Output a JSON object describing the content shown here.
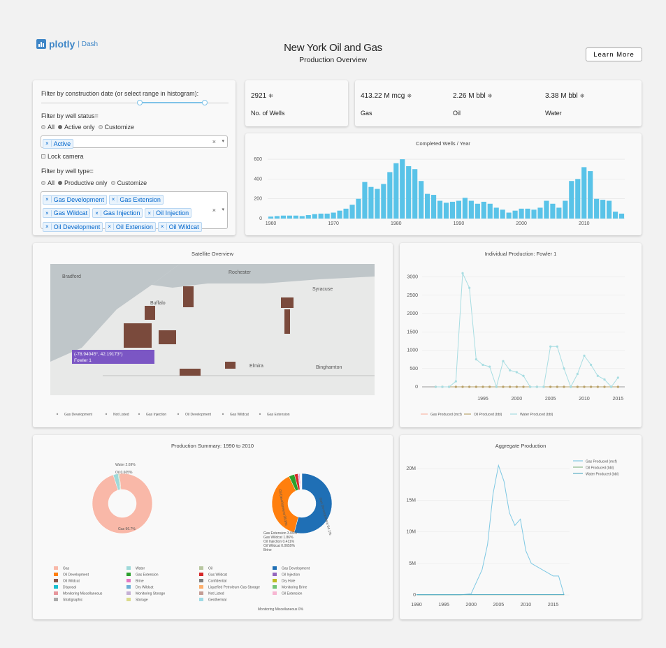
{
  "header": {
    "logo_text": "plotly",
    "logo_sub": "Dash",
    "title": "New York Oil and Gas",
    "subtitle": "Production Overview",
    "learn_more": "Learn More"
  },
  "controls": {
    "date_label": "Filter by construction date (or select range in histogram):",
    "status_label": "Filter by well status=",
    "status_options": [
      "All",
      "Active only",
      "Customize"
    ],
    "status_selected": "Active only",
    "status_tags": [
      "Active"
    ],
    "lock_camera": "Lock camera",
    "type_label": "Filter by well type=",
    "type_options": [
      "All",
      "Productive only",
      "Customize"
    ],
    "type_selected": "Productive only",
    "type_tags": [
      "Gas Development",
      "Gas Extension",
      "Gas Wildcat",
      "Gas Injection",
      "Oil Injection",
      "Oil Development",
      "Oil Extension",
      "Oil Wildcat"
    ]
  },
  "stats": [
    {
      "value": "2921",
      "label": "No. of Wells"
    },
    {
      "value": "413.22 M mcg",
      "label": "Gas"
    },
    {
      "value": "2.26 M bbl",
      "label": "Oil"
    },
    {
      "value": "3.38 M bbl",
      "label": "Water"
    }
  ],
  "map": {
    "title": "Satellite Overview",
    "tooltip_coords": "(-78.94045°, 42.19173°)",
    "tooltip_type": "Gas Extension",
    "tooltip_name": "Fowler 1",
    "legend": [
      "Gas Development",
      "Not Listed",
      "Gas Injection",
      "Oil Development",
      "Gas Wildcat",
      "Gas Extension"
    ],
    "place_labels": [
      "Rochester",
      "Syracuse",
      "Bradford",
      "Buffalo",
      "Binghamton",
      "Elmira"
    ]
  },
  "chart_data": [
    {
      "type": "bar",
      "title": "Completed Wells / Year",
      "color": "#59c3e8",
      "x": [
        1960,
        1961,
        1962,
        1963,
        1964,
        1965,
        1966,
        1967,
        1968,
        1969,
        1970,
        1971,
        1972,
        1973,
        1974,
        1975,
        1976,
        1977,
        1978,
        1979,
        1980,
        1981,
        1982,
        1983,
        1984,
        1985,
        1986,
        1987,
        1988,
        1989,
        1990,
        1991,
        1992,
        1993,
        1994,
        1995,
        1996,
        1997,
        1998,
        1999,
        2000,
        2001,
        2002,
        2003,
        2004,
        2005,
        2006,
        2007,
        2008,
        2009,
        2010,
        2011,
        2012,
        2013,
        2014,
        2015,
        2016
      ],
      "values": [
        20,
        25,
        30,
        30,
        30,
        25,
        35,
        45,
        50,
        50,
        60,
        80,
        100,
        140,
        200,
        370,
        320,
        300,
        350,
        470,
        560,
        600,
        530,
        500,
        380,
        250,
        240,
        180,
        160,
        170,
        180,
        210,
        180,
        150,
        170,
        150,
        110,
        90,
        60,
        80,
        100,
        100,
        90,
        110,
        180,
        150,
        110,
        180,
        380,
        400,
        520,
        480,
        200,
        190,
        180,
        70,
        50
      ],
      "xticks": [
        1960,
        1970,
        1980,
        1990,
        2000,
        2010
      ],
      "yticks": [
        0,
        200,
        400,
        600
      ],
      "ylim": [
        0,
        650
      ]
    },
    {
      "type": "line",
      "title": "Individual Production: Fowler 1",
      "series": [
        {
          "name": "Gas Produced (mcf)",
          "color": "#f9b8a8",
          "x": [
            1988,
            1989,
            1990,
            1991,
            1992,
            1993,
            1994,
            1995,
            1996,
            1997,
            1998,
            1999,
            2000,
            2001,
            2002,
            2003,
            2004,
            2005,
            2006,
            2007,
            2008,
            2009,
            2010,
            2011,
            2012,
            2013,
            2014,
            2015
          ],
          "values": [
            0,
            0,
            0,
            0,
            0,
            0,
            0,
            0,
            0,
            0,
            0,
            0,
            0,
            0,
            0,
            0,
            0,
            0,
            0,
            0,
            0,
            0,
            0,
            0,
            0,
            0,
            0,
            0
          ]
        },
        {
          "name": "Oil Produced (bbl)",
          "color": "#b8a36b",
          "x": [
            1988,
            1989,
            1990,
            1991,
            1992,
            1993,
            1994,
            1995,
            1996,
            1997,
            1998,
            1999,
            2000,
            2001,
            2002,
            2003,
            2004,
            2005,
            2006,
            2007,
            2008,
            2009,
            2010,
            2011,
            2012,
            2013,
            2014,
            2015
          ],
          "values": [
            0,
            0,
            0,
            0,
            0,
            0,
            0,
            0,
            0,
            0,
            0,
            0,
            0,
            0,
            0,
            0,
            0,
            0,
            0,
            0,
            0,
            0,
            0,
            0,
            0,
            0,
            0,
            0
          ]
        },
        {
          "name": "Water Produced (bbl)",
          "color": "#a8dde2",
          "x": [
            1988,
            1989,
            1990,
            1991,
            1992,
            1993,
            1994,
            1995,
            1996,
            1997,
            1998,
            1999,
            2000,
            2001,
            2002,
            2003,
            2004,
            2005,
            2006,
            2007,
            2008,
            2009,
            2010,
            2011,
            2012,
            2013,
            2014,
            2015
          ],
          "values": [
            0,
            0,
            0,
            150,
            3100,
            2700,
            750,
            600,
            550,
            0,
            700,
            450,
            400,
            300,
            0,
            0,
            0,
            1100,
            1100,
            500,
            0,
            350,
            850,
            600,
            300,
            200,
            0,
            250
          ]
        }
      ],
      "xticks": [
        1995,
        2000,
        2005,
        2010,
        2015
      ],
      "yticks": [
        0,
        500,
        1000,
        1500,
        2000,
        2500,
        3000
      ],
      "ylim": [
        0,
        3200
      ],
      "xlim": [
        1986,
        2016
      ]
    },
    {
      "type": "pie",
      "title": "Production Summary: 1990 to 2010",
      "slices": [
        {
          "label": "Gas",
          "percent": 96.7,
          "color": "#f9b8a8"
        },
        {
          "label": "Water",
          "percent": 2.69,
          "color": "#9ed9d9"
        },
        {
          "label": "Oil",
          "percent": 0.605,
          "color": "#b8c7a0"
        }
      ],
      "slice_labels": [
        "Water 2.69%",
        "Oil 0.605%",
        "Gas 96.7%"
      ]
    },
    {
      "type": "pie",
      "title": "Production Summary: 1990 to 2010",
      "slices": [
        {
          "label": "Gas Development",
          "percent": 54.1,
          "color": "#1f6fb5"
        },
        {
          "label": "Oil Development",
          "percent": 38.8,
          "color": "#ff7f0e"
        },
        {
          "label": "Gas Extension",
          "percent": 3.09,
          "color": "#2ca02c"
        },
        {
          "label": "Gas Wildcat",
          "percent": 1.86,
          "color": "#d62728"
        },
        {
          "label": "Oil Injection",
          "percent": 0.411,
          "color": "#9467bd"
        },
        {
          "label": "Oil Wildcat",
          "percent": 0.0659,
          "color": "#8c564b"
        },
        {
          "label": "Brine",
          "percent": 0.5,
          "color": "#e377c2"
        },
        {
          "label": "Monitoring Miscellaneous",
          "percent": 0.1,
          "color": "#666"
        }
      ],
      "slice_labels": [
        "Gas Development 54.1%",
        "Oil Development 38.8%",
        "Gas Extension 3.09%",
        "Gas Wildcat 1.86%",
        "Oil Injection 0.411%",
        "Oil Wildcat 0.0659%",
        "Brine",
        "Monitoring Miscellaneous 0%"
      ]
    },
    {
      "type": "line",
      "title": "Aggregate Production",
      "series": [
        {
          "name": "Gas Produced (mcf)",
          "color": "#7ec8e3",
          "x": [
            1990,
            1995,
            1998,
            2000,
            2002,
            2003,
            2004,
            2005,
            2006,
            2007,
            2008,
            2009,
            2010,
            2011,
            2012,
            2013,
            2014,
            2015,
            2016,
            2017
          ],
          "values": [
            0,
            0,
            0,
            200000,
            4000000,
            8000000,
            16000000,
            20500000,
            18000000,
            13000000,
            11000000,
            12000000,
            7000000,
            5000000,
            4500000,
            4000000,
            3500000,
            3000000,
            3000000,
            0
          ]
        },
        {
          "name": "Oil Produced (bbl)",
          "color": "#8bb98b",
          "x": [
            1990,
            2017
          ],
          "values": [
            30000,
            30000
          ]
        },
        {
          "name": "Water Produced (bbl)",
          "color": "#5aaec4",
          "x": [
            1990,
            2017
          ],
          "values": [
            50000,
            50000
          ]
        }
      ],
      "xticks": [
        1990,
        1995,
        2000,
        2005,
        2010,
        2015
      ],
      "ytick_labels": [
        "0",
        "5M",
        "10M",
        "15M",
        "20M"
      ],
      "yticks": [
        0,
        5000000,
        10000000,
        15000000,
        20000000
      ],
      "ylim": [
        0,
        22000000
      ],
      "xlim": [
        1990,
        2018
      ]
    }
  ],
  "pie_legend": [
    {
      "label": "Gas",
      "color": "#f9b8a8"
    },
    {
      "label": "Water",
      "color": "#9ed9d9"
    },
    {
      "label": "Oil",
      "color": "#b8c7a0"
    },
    {
      "label": "Gas Development",
      "color": "#1f6fb5"
    },
    {
      "label": "Oil Development",
      "color": "#ff7f0e"
    },
    {
      "label": "Gas Extension",
      "color": "#2ca02c"
    },
    {
      "label": "Gas Wildcat",
      "color": "#d62728"
    },
    {
      "label": "Oil Injection",
      "color": "#9467bd"
    },
    {
      "label": "Oil Wildcat",
      "color": "#8c564b"
    },
    {
      "label": "Brine",
      "color": "#e377c2"
    },
    {
      "label": "Confidential",
      "color": "#7f7f7f"
    },
    {
      "label": "Dry Hole",
      "color": "#bcbd22"
    },
    {
      "label": "Disposal",
      "color": "#17becf"
    },
    {
      "label": "Dry Wildcat",
      "color": "#6baed6"
    },
    {
      "label": "Liquefied Petroleum Gas Storage",
      "color": "#fdae6b"
    },
    {
      "label": "Monitoring Brine",
      "color": "#74c476"
    },
    {
      "label": "Monitoring Miscellaneous",
      "color": "#e7969c"
    },
    {
      "label": "Monitoring Storage",
      "color": "#c5b0d5"
    },
    {
      "label": "Not Listed",
      "color": "#c49c94"
    },
    {
      "label": "Oil Extension",
      "color": "#f7b6d2"
    },
    {
      "label": "Stratigraphic",
      "color": "#aaaaaa"
    },
    {
      "label": "Storage",
      "color": "#dbdb8d"
    },
    {
      "label": "Geothermal",
      "color": "#9edae5"
    }
  ]
}
